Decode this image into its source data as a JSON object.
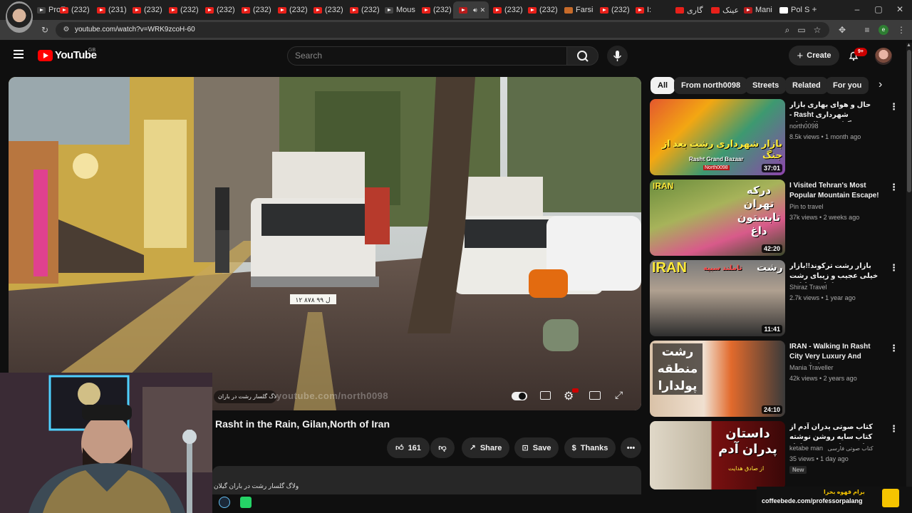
{
  "browser": {
    "tabs": [
      {
        "label": "ProFe"
      },
      {
        "label": "(232)"
      },
      {
        "label": "(231)"
      },
      {
        "label": "(232)"
      },
      {
        "label": "(232)"
      },
      {
        "label": "(232)"
      },
      {
        "label": "(232)"
      },
      {
        "label": "(232)"
      },
      {
        "label": "(232)"
      },
      {
        "label": "(232)"
      },
      {
        "label": "Mous"
      },
      {
        "label": "(232)"
      },
      {
        "label": ""
      },
      {
        "label": "(232)"
      },
      {
        "label": "(232)"
      },
      {
        "label": "Farsi"
      },
      {
        "label": "(232)"
      },
      {
        "label": "I:"
      },
      {
        "label": "گاری"
      },
      {
        "label": "عینک"
      },
      {
        "label": "Mani"
      },
      {
        "label": "Pol S"
      }
    ],
    "url": "youtube.com/watch?v=WRK9zcoH-60",
    "profile_initial": "e"
  },
  "youtube": {
    "logo_text": "YouTube",
    "region": "GB",
    "search_placeholder": "Search",
    "create_label": "Create",
    "notifications": "9+"
  },
  "video": {
    "title": "Rasht in the Rain, Gilan,North of Iran",
    "watermark": "youtube.com/north0098",
    "chapter": "ولاگ گلسار رشت در باران",
    "likes": "161",
    "share_label": "Share",
    "save_label": "Save",
    "thanks_label": "Thanks",
    "description_snippet": "ولاگ گلسار رشت در باران گیلان",
    "plate": "۱۲ ۸۷۸ ل ۹۹"
  },
  "chips": [
    "All",
    "From north0098",
    "Streets",
    "Related",
    "For you"
  ],
  "related": [
    {
      "title": "حال و هوای بهاری بازار شهرداری Rasht - رشت،گیلان،شمال ایران",
      "channel": "north0098",
      "meta": "8.5k views • 1 month ago",
      "duration": "37:01",
      "thumb_text": "بازار شهرداری رشت بعد از جنگ",
      "thumb_sub": "Rasht Grand Bazaar",
      "thumb_channel": "North0098"
    },
    {
      "title": "I Visited Tehran's Most Popular Mountain Escape!",
      "channel": "Pin to travel",
      "meta": "37k views • 2 weeks ago",
      "duration": "42:20",
      "thumb_text": "درکه تهران تابستون داغ",
      "thumb_label": "IRAN"
    },
    {
      "title": "بازار رشت ترکوند!!بازار خیلی عجیب و زیبای رشت و غذاهای خیابانی",
      "channel": "Shiraz Travel",
      "meta": "2.7k views • 1 year ago",
      "duration": "11:41",
      "thumb_text": "رشت",
      "thumb_label": "IRAN",
      "thumb_sub": "تاملند سبیه"
    },
    {
      "title": "IRAN - Walking In Rasht City Very Luxury And Crowded",
      "channel": "Mania Traveller",
      "meta": "42k views • 2 years ago",
      "duration": "24:10",
      "thumb_text": "رشت منطقه پولدارا"
    },
    {
      "title": "کتاب صوتی پدران آدم از کتاب سایه روشن نوشته صادق هدایت - بخش اول",
      "channel": "ketabe man",
      "channel_sub": "کتاب صوتی فارسی",
      "meta": "35 views • 1 day ago",
      "badge": "New",
      "thumb_text": "داستان پدران آدم",
      "thumb_sub": "از صادق هدایت"
    }
  ],
  "overlay": {
    "coffee_title": "برام قهوه بخرا",
    "coffee_url": "coffeebede.com/professorpalang"
  }
}
